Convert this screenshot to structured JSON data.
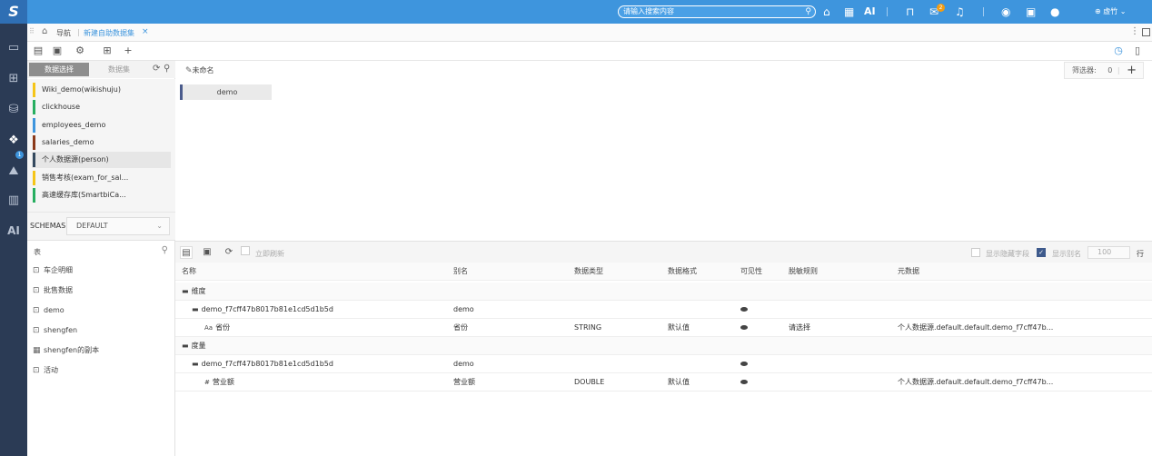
{
  "topbar": {
    "logo": "S",
    "search_placeholder": "请输入搜索内容",
    "ai_label": "AI",
    "message_badge": "2",
    "user_name": "虚竹"
  },
  "leftnav": {
    "badge": "1",
    "ai_label": "AI"
  },
  "tabbar": {
    "nav_label": "导航",
    "active_tab": "新建自助数据集"
  },
  "datasource": {
    "tab_select": "数据选择",
    "tab_dataset": "数据集",
    "items": [
      {
        "name": "Wiki_demo(wikishuju)",
        "color": "#f5c518"
      },
      {
        "name": "clickhouse",
        "color": "#27ae60"
      },
      {
        "name": "employees_demo",
        "color": "#3e95dd"
      },
      {
        "name": "salaries_demo",
        "color": "#8b3a1a"
      },
      {
        "name": "个人数据源(person)",
        "color": "#34495e"
      },
      {
        "name": "销售考核(exam_for_sal...",
        "color": "#f5c518"
      },
      {
        "name": "高速缓存库(SmartbiCa...",
        "color": "#27ae60"
      }
    ],
    "schema_label": "SCHEMAS",
    "schema_value": "DEFAULT",
    "tables_label": "表",
    "tables": [
      {
        "name": "车企明细",
        "icon": "view"
      },
      {
        "name": "批售数据",
        "icon": "view"
      },
      {
        "name": "demo",
        "icon": "view"
      },
      {
        "name": "shengfen",
        "icon": "view"
      },
      {
        "name": "shengfen的副本",
        "icon": "table"
      },
      {
        "name": "活动",
        "icon": "view"
      }
    ]
  },
  "canvas": {
    "dataset_name": "未命名",
    "filter_label": "筛选器:",
    "filter_count": "0",
    "node_label": "demo"
  },
  "fieldsbar": {
    "refresh_label": "立即刷新",
    "show_hidden_label": "显示隐藏字段",
    "show_alias_label": "显示别名",
    "rows_value": "100",
    "rows_unit": "行"
  },
  "grid": {
    "headers": [
      "名称",
      "别名",
      "数据类型",
      "数据格式",
      "可见性",
      "脱敏规则",
      "元数据"
    ],
    "rows": [
      {
        "kind": "group",
        "name": "维度"
      },
      {
        "kind": "folder",
        "name": "demo_f7cff47b8017b81e1cd5d1b5d",
        "alias": "demo",
        "type": "",
        "format": "",
        "visible": true,
        "mask": "",
        "meta": ""
      },
      {
        "kind": "field",
        "icon": "Aa",
        "name": "省份",
        "alias": "省份",
        "type": "STRING",
        "format": "默认值",
        "visible": true,
        "mask": "请选择",
        "meta": "个人数据源.default.default.demo_f7cff47b..."
      },
      {
        "kind": "group",
        "name": "度量"
      },
      {
        "kind": "folder",
        "name": "demo_f7cff47b8017b81e1cd5d1b5d",
        "alias": "demo",
        "type": "",
        "format": "",
        "visible": true,
        "mask": "",
        "meta": ""
      },
      {
        "kind": "field",
        "icon": "#",
        "name": "营业额",
        "alias": "营业额",
        "type": "DOUBLE",
        "format": "默认值",
        "visible": true,
        "mask": "",
        "meta": "个人数据源.default.default.demo_f7cff47b..."
      }
    ]
  }
}
